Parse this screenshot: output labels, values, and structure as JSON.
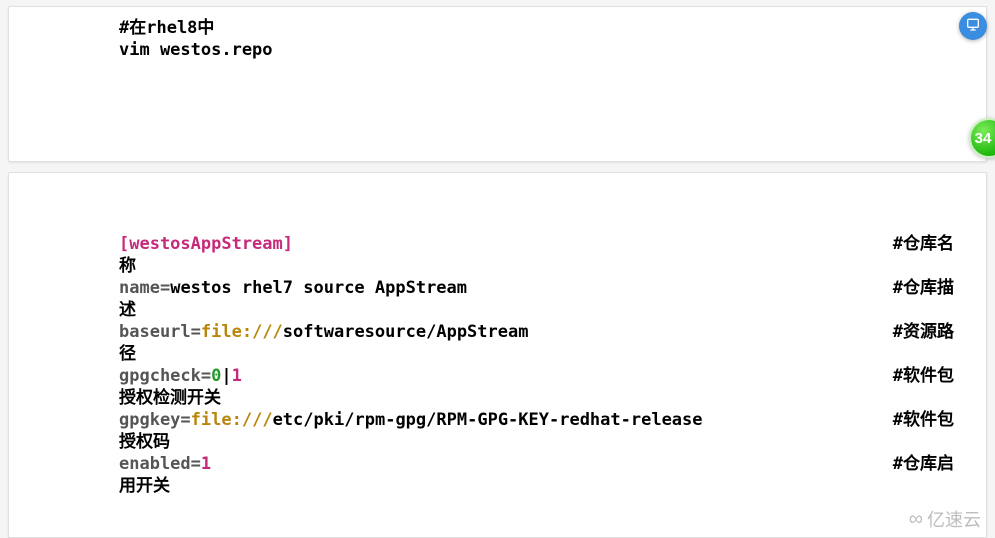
{
  "sheet1": {
    "line1": "#在rhel8中",
    "line2": "vim westos.repo"
  },
  "sheet2": {
    "rows": [
      {
        "left_pre": "",
        "left_kw": "[westosAppStream]",
        "left_post": "",
        "right": "#仓库名",
        "wrap": "称"
      },
      {
        "prop": "name",
        "eq": "=",
        "val_plain": "westos rhel7 source AppStream",
        "right": "#仓库描",
        "wrap": "述"
      },
      {
        "prop": "baseurl",
        "eq": "=",
        "url": "file:///",
        "path_parts": [
          "softwaresource",
          "AppStream"
        ],
        "right": "#资源路",
        "wrap": "径"
      },
      {
        "prop": "gpgcheck",
        "eq": "=",
        "num0": "0",
        "sep": "|",
        "num1": "1",
        "right": "#软件包",
        "wrap": "授权检测开关"
      },
      {
        "prop": "gpgkey",
        "eq": "=",
        "url": "file:///",
        "path_parts": [
          "etc",
          "pki",
          "rpm-gpg",
          "RPM-GPG-KEY-redhat-release"
        ],
        "right": "#软件包",
        "wrap": "授权码"
      },
      {
        "prop": "enabled",
        "eq": "=",
        "num1": "1",
        "right": "#仓库启",
        "wrap": "用开关"
      }
    ]
  },
  "badge": {
    "text": "34"
  },
  "watermark": {
    "text": "亿速云"
  }
}
